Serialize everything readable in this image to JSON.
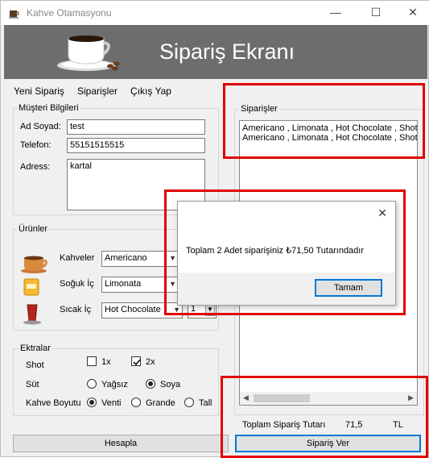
{
  "window": {
    "title": "Kahve Otamasyonu",
    "minimize_icon": "—",
    "maximize_icon": "☐",
    "close_icon": "✕"
  },
  "header": {
    "title": "Sipariş Ekranı"
  },
  "menu": [
    "Yeni Sipariş",
    "Siparişler",
    "Çıkış Yap"
  ],
  "customer": {
    "group_title": "Müşteri Bilgileri",
    "name_label": "Ad Soyad:",
    "name_value": "test",
    "phone_label": "Telefon:",
    "phone_value": "55151515515",
    "address_label": "Adress:",
    "address_value": "kartal"
  },
  "products": {
    "group_title": "Ürünler",
    "coffee_label": "Kahveler",
    "coffee_value": "Americano",
    "cold_label": "Soğuk İç",
    "cold_value": "Limonata",
    "hot_label": "Sıcak İç",
    "hot_value": "Hot Chocolate",
    "hot_qty": "1"
  },
  "extras": {
    "group_title": "Ektralar",
    "shot_label": "Shot",
    "shot_1x": "1x",
    "shot_2x": "2x",
    "milk_label": "Süt",
    "milk_fat_free": "Yağsız",
    "milk_soy": "Soya",
    "size_label": "Kahve Boyutu",
    "size_venti": "Venti",
    "size_grande": "Grande",
    "size_tall": "Tall"
  },
  "orders": {
    "group_title": "Siparişler",
    "items": [
      "Americano , Limonata , Hot Chocolate ,  Shot",
      "Americano , Limonata , Hot Chocolate ,  Shot"
    ]
  },
  "totals": {
    "label": "Toplam Sipariş Tutarı",
    "value": "71,5",
    "currency": "TL"
  },
  "buttons": {
    "calculate": "Hesapla",
    "order": "Sipariş Ver"
  },
  "dialog": {
    "message": "Toplam 2 Adet siparişiniz ₺71,50 Tutarındadır",
    "ok": "Tamam",
    "close_icon": "✕"
  },
  "colors": {
    "header_bg": "#6d6d6d",
    "highlight": "#e00000",
    "focus_border": "#0078d7"
  }
}
